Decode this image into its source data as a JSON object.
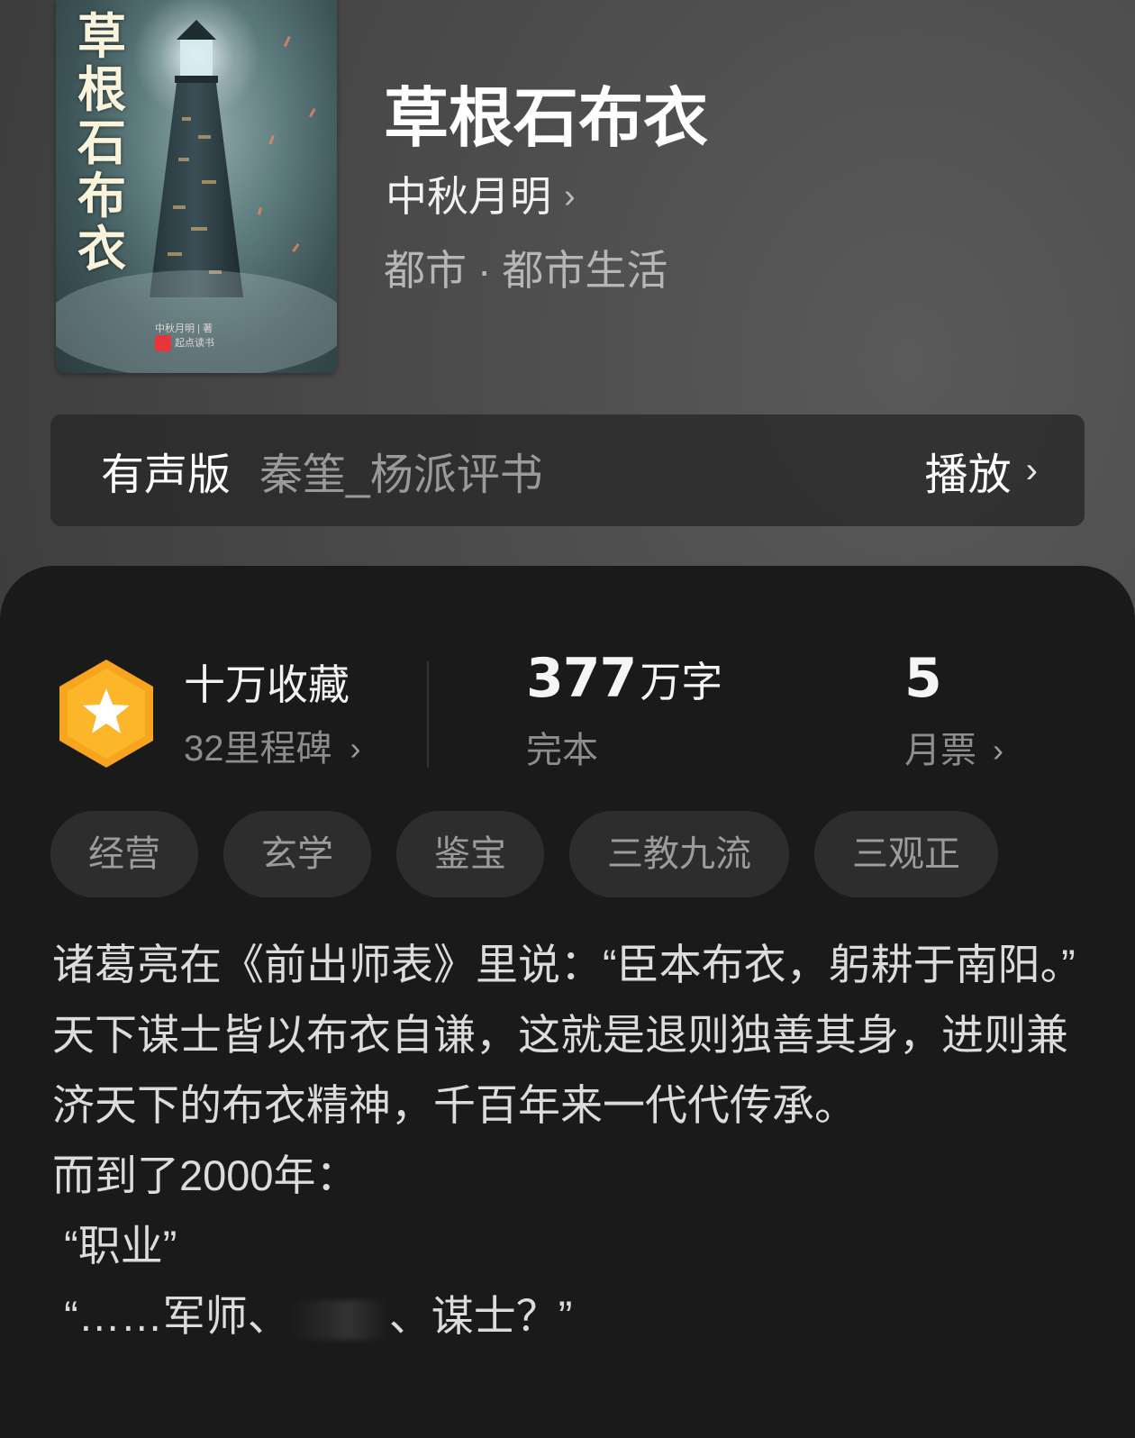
{
  "book": {
    "cover_title_chars": [
      "草",
      "根",
      "石",
      "布",
      "衣"
    ],
    "cover_credit_line1": "中秋月明 | 著",
    "cover_credit_line2": "起点读书",
    "title": "草根石布衣",
    "author": "中秋月明",
    "author_chevron": "›",
    "category_main": "都市",
    "category_dot": "·",
    "category_sub": "都市生活"
  },
  "audio": {
    "label": "有声版",
    "narrator": "秦筀_杨派评书",
    "play_label": "播放",
    "chevron": "›"
  },
  "stats": {
    "favorites": "十万收藏",
    "milestones": "32里程碑",
    "word_count_number": "377",
    "word_count_unit": "万字",
    "status": "完本",
    "monthly_votes": "5",
    "monthly_votes_label": "月票",
    "chevron": "›",
    "badge_color": "#f7a51c"
  },
  "tags": [
    "经营",
    "玄学",
    "鉴宝",
    "三教九流",
    "三观正"
  ],
  "synopsis": {
    "line1": "诸葛亮在《前出师表》里说：“臣本布衣，躬耕于南阳。”",
    "line2": "天下谋士皆以布衣自谦，这就是退则独善其身，进则兼济天下的布衣精神，千百年来一代代传承。",
    "line3": "而到了2000年：",
    "line4": " “职业”",
    "line5_before": " “……军师、",
    "line5_after": "、谋士？”"
  }
}
